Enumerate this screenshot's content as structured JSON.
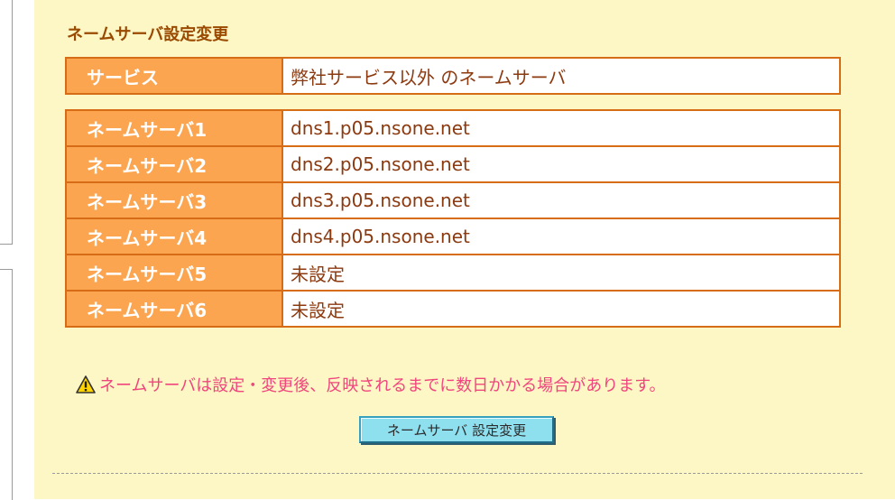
{
  "section": {
    "title": "ネームサーバ設定変更"
  },
  "service_row": {
    "label": "サービス",
    "value": "弊社サービス以外 のネームサーバ"
  },
  "nameservers": [
    {
      "label": "ネームサーバ1",
      "value": "dns1.p05.nsone.net"
    },
    {
      "label": "ネームサーバ2",
      "value": "dns2.p05.nsone.net"
    },
    {
      "label": "ネームサーバ3",
      "value": "dns3.p05.nsone.net"
    },
    {
      "label": "ネームサーバ4",
      "value": "dns4.p05.nsone.net"
    },
    {
      "label": "ネームサーバ5",
      "value": "未設定"
    },
    {
      "label": "ネームサーバ6",
      "value": "未設定"
    }
  ],
  "notice": {
    "icon": "warning-icon",
    "text": "ネームサーバは設定・変更後、反映されるまでに数日かかる場合があります。"
  },
  "submit_button": {
    "label": "ネームサーバ 設定変更"
  },
  "colors": {
    "panel_bg": "#fdf6c5",
    "label_bg": "#fca551",
    "border": "#d66c16",
    "title": "#9a4a00",
    "value_text": "#8c3a10",
    "notice_text": "#f0457d",
    "button_bg": "#8fe0ef"
  }
}
